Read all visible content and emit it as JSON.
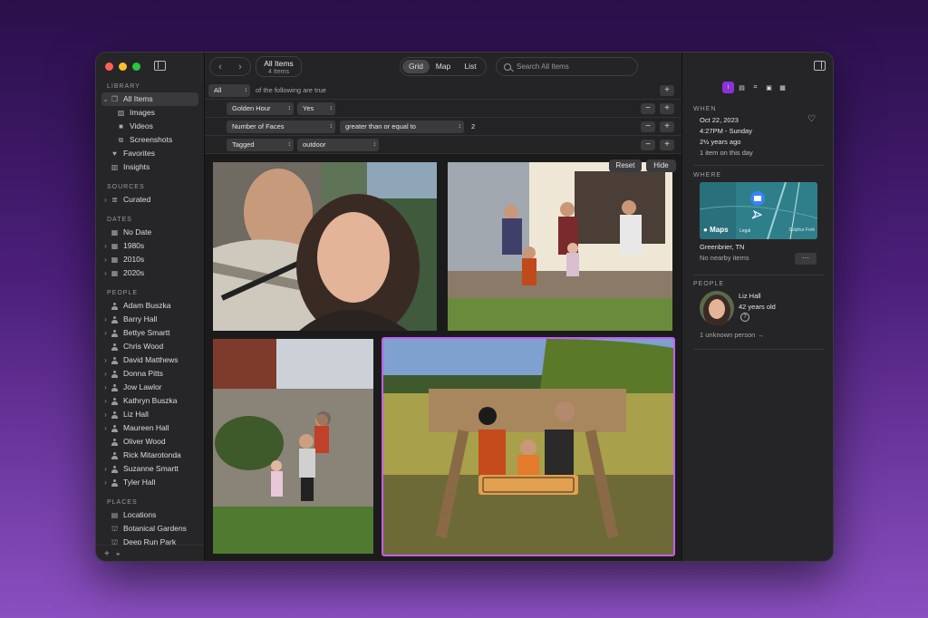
{
  "sidebar": {
    "library_header": "LIBRARY",
    "library": [
      {
        "label": "All Items",
        "icon": "all-items-icon",
        "selected": true
      },
      {
        "label": "Images",
        "icon": "image-icon"
      },
      {
        "label": "Videos",
        "icon": "video-icon"
      },
      {
        "label": "Screenshots",
        "icon": "screenshot-icon"
      },
      {
        "label": "Favorites",
        "icon": "heart-icon"
      },
      {
        "label": "Insights",
        "icon": "chart-icon"
      }
    ],
    "sources_header": "SOURCES",
    "sources": [
      {
        "label": "Curated"
      }
    ],
    "dates_header": "DATES",
    "dates": [
      {
        "label": "No Date"
      },
      {
        "label": "1980s"
      },
      {
        "label": "2010s"
      },
      {
        "label": "2020s"
      }
    ],
    "people_header": "PEOPLE",
    "people": [
      "Adam Buszka",
      "Barry Hall",
      "Bettye Smartt",
      "Chris Wood",
      "David Matthews",
      "Donna Pitts",
      "Jow Lawlor",
      "Kathryn Buszka",
      "Liz Hall",
      "Maureen Hall",
      "Oliver Wood",
      "Rick Mitarotonda",
      "Suzanne Smartt",
      "Tyler Hall"
    ],
    "places_header": "PLACES",
    "places": [
      {
        "label": "Locations"
      },
      {
        "label": "Botanical Gardens"
      },
      {
        "label": "Deep Run Park"
      }
    ]
  },
  "toolbar": {
    "title": "All Items",
    "subtitle": "4 Items",
    "views": [
      "Grid",
      "Map",
      "List"
    ],
    "active_view": "Grid",
    "search_placeholder": "Search All Items"
  },
  "filters": {
    "match": "All",
    "match_suffix": "of the following are true",
    "rows": [
      {
        "field": "Golden Hour",
        "value": "Yes"
      },
      {
        "field": "Number of Faces",
        "operator": "greater than or equal to",
        "value": "2"
      },
      {
        "field": "Tagged",
        "value": "outdoor"
      }
    ]
  },
  "grid": {
    "reset_label": "Reset",
    "hide_label": "Hide"
  },
  "inspector": {
    "when_header": "WHEN",
    "date": "Oct 22, 2023",
    "time": "4:27PM - Sunday",
    "age": "2½ years ago",
    "on_day": "1 item on this day",
    "where_header": "WHERE",
    "maps_brand": "Maps",
    "legal": "Legal",
    "map_road": "Sulphur Fork",
    "place": "Greenbrier, TN",
    "nearby": "No nearby items",
    "people_header": "PEOPLE",
    "person_name": "Liz Hall",
    "person_age": "42 years old",
    "unknown": "1 unknown person"
  }
}
